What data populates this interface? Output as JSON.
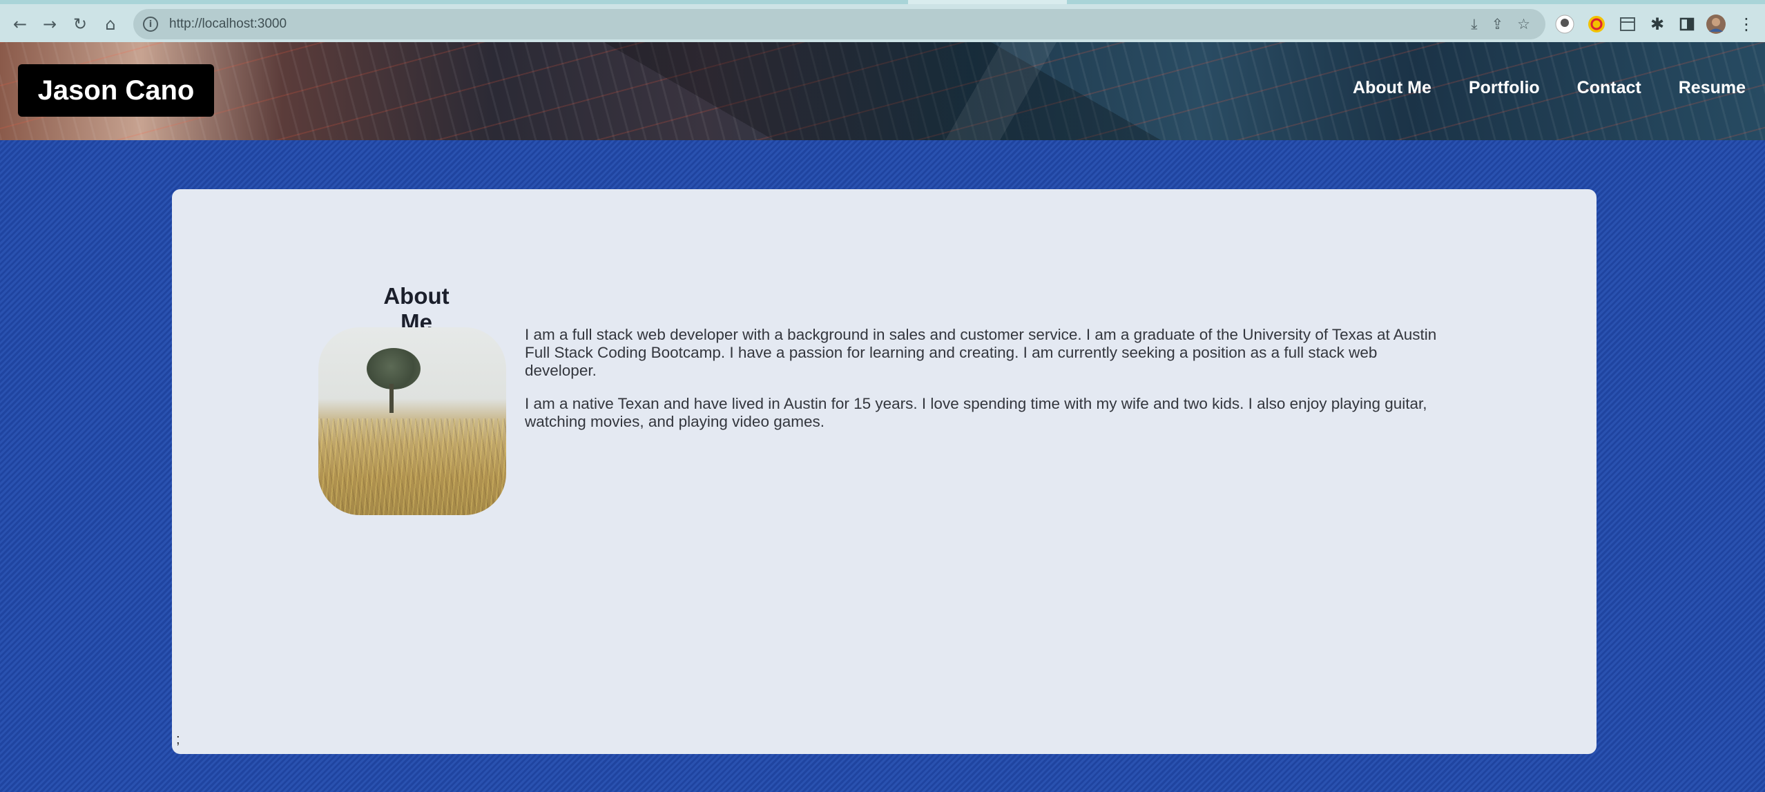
{
  "browser": {
    "url": "http://localhost:3000",
    "icons": [
      "back-icon",
      "forward-icon",
      "reload-icon",
      "home-icon",
      "site-info-icon",
      "install-icon",
      "share-icon",
      "bookmark-star-icon",
      "extension-1-icon",
      "extension-2-icon",
      "extension-3-icon",
      "puzzle-extensions-icon",
      "side-panel-icon",
      "profile-avatar-icon",
      "menu-kebab-icon"
    ]
  },
  "site": {
    "brand": "Jason Cano",
    "nav": [
      "About Me",
      "Portfolio",
      "Contact",
      "Resume"
    ]
  },
  "about": {
    "title": "About Me",
    "paragraphs": [
      "I am a full stack web developer with a background in sales and customer service. I am a graduate of the University of Texas at Austin Full Stack Coding Bootcamp. I have a passion for learning and creating. I am currently seeking a position as a full stack web developer.",
      "I am a native Texan and have lived in Austin for 15 years. I love spending time with my wife and two kids. I also enjoy playing guitar, watching movies, and playing video games."
    ],
    "stray_text": ";"
  },
  "colors": {
    "page_background": "#2249a3",
    "card_background": "#e4e9f2",
    "brand_background": "#000000",
    "nav_text": "#ffffff"
  }
}
